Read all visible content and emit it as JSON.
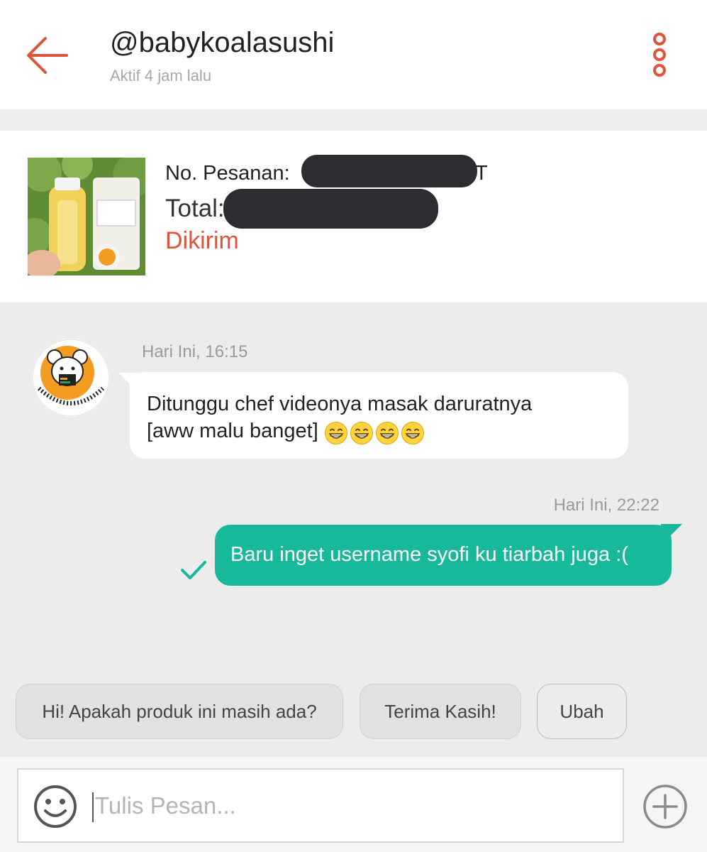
{
  "header": {
    "title": "@babykoalasushi",
    "subtitle": "Aktif 4 jam lalu",
    "accent_color": "#e0533a"
  },
  "order": {
    "number_label": "No. Pesanan: ",
    "number_tail": "T",
    "total_label": "Total:",
    "status": "Dikirim"
  },
  "messages": [
    {
      "direction": "incoming",
      "timestamp": "Hari Ini, 16:15",
      "text_line1": "Ditunggu chef videonya masak daruratnya",
      "text_line2": "[aww malu banget]",
      "emoji": "grinning-face-icon",
      "emoji_count": 4
    },
    {
      "direction": "outgoing",
      "timestamp": "Hari Ini, 22:22",
      "text": "Baru inget username syofi ku tiarbah juga :(",
      "bubble_color": "#18b89a"
    }
  ],
  "quick_replies": [
    "Hi! Apakah produk ini masih ada?",
    "Terima Kasih!",
    "Ubah"
  ],
  "composer": {
    "placeholder": "Tulis Pesan..."
  }
}
